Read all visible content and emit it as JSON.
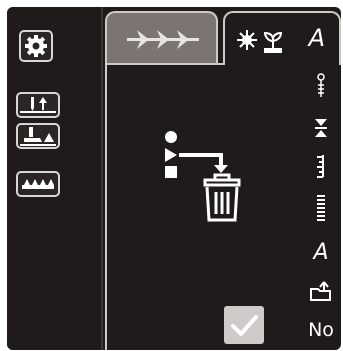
{
  "tabs": {
    "tab2_letter": "A"
  },
  "right_panel": {
    "letter_a": "A",
    "no_label": "No"
  },
  "colors": {
    "background": "#1e1b1a",
    "active_tab": "#1e1b1a",
    "inactive_tab": "#7b7471",
    "icon": "#ffffff",
    "ok_button": "#cfcac7"
  },
  "icons": {
    "settings": "gear-icon",
    "needle_up": "needle-up-icon",
    "presser_foot": "presser-foot-icon",
    "feed_dogs": "feed-dogs-icon",
    "tab1": "stitch-arrows-icon",
    "tab2": "embroidery-letter-icon",
    "delete": "delete-trash-icon",
    "ok": "checkmark-icon"
  }
}
